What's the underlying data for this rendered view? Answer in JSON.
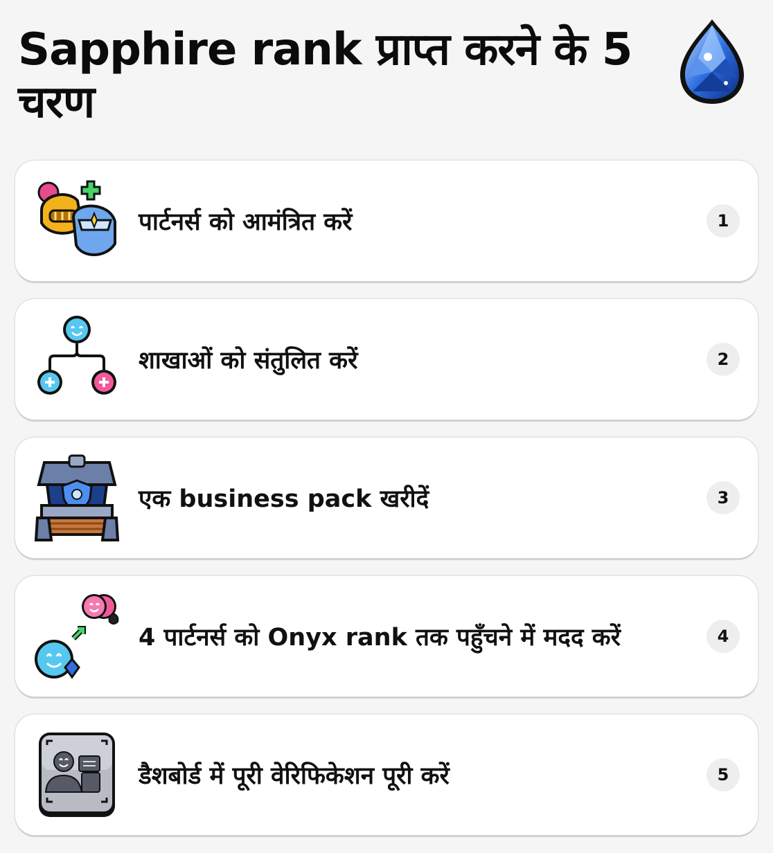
{
  "header": {
    "title": "Sapphire rank प्राप्त करने के 5 चरण",
    "gem_icon": "sapphire-gem-icon"
  },
  "steps": [
    {
      "number": "1",
      "label": "पार्टनर्स को आमंत्रित करें",
      "icon": "helmets-plus-icon"
    },
    {
      "number": "2",
      "label": "शाखाओं को संतुलित करें",
      "icon": "branch-tree-icon"
    },
    {
      "number": "3",
      "label": "एक business pack खरीदें",
      "icon": "treasure-chest-icon"
    },
    {
      "number": "4",
      "label": "4 पार्टनर्स को Onyx rank तक पहुँचने में मदद करें",
      "icon": "partners-rank-up-icon"
    },
    {
      "number": "5",
      "label": "डैशबोर्ड में पूरी वेरिफिकेशन पूरी करें",
      "icon": "id-verification-icon"
    }
  ],
  "colors": {
    "background": "#f5f5f5",
    "card": "#ffffff",
    "badge": "#eeeeee",
    "sapphire": "#2f6fe0"
  }
}
